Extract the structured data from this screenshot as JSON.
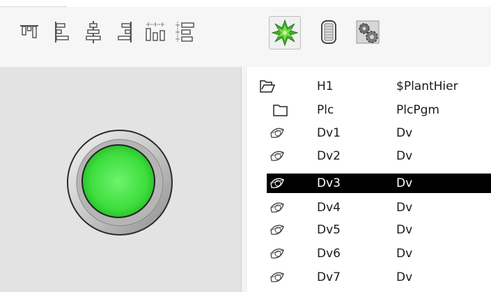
{
  "toolbar": {
    "buttons": [
      {
        "icon": "align-top-icon"
      },
      {
        "icon": "align-left-icon"
      },
      {
        "icon": "align-center-vertical-icon"
      },
      {
        "icon": "align-right-icon"
      },
      {
        "icon": "distribute-horizontal-icon"
      },
      {
        "icon": "distribute-vertical-icon"
      },
      {
        "icon": "starburst-icon",
        "active": true
      },
      {
        "icon": "scroll-panel-icon"
      },
      {
        "icon": "gears-icon"
      }
    ]
  },
  "indicator": {
    "state": "on",
    "color": "#2fd12f"
  },
  "tree": {
    "rows": [
      {
        "icon": "open-folder-icon",
        "name": "H1",
        "class": "$PlantHier",
        "selected": false
      },
      {
        "icon": "folder-icon",
        "name": "Plc",
        "class": "PlcPgm",
        "selected": false
      },
      {
        "icon": "leaf-icon",
        "name": "Dv1",
        "class": "Dv",
        "selected": false
      },
      {
        "icon": "leaf-icon",
        "name": "Dv2",
        "class": "Dv",
        "selected": false
      },
      {
        "icon": "leaf-icon",
        "name": "Dv3",
        "class": "Dv",
        "selected": true
      },
      {
        "icon": "leaf-icon",
        "name": "Dv4",
        "class": "Dv",
        "selected": false
      },
      {
        "icon": "leaf-icon",
        "name": "Dv5",
        "class": "Dv",
        "selected": false
      },
      {
        "icon": "leaf-icon",
        "name": "Dv6",
        "class": "Dv",
        "selected": false
      },
      {
        "icon": "leaf-icon",
        "name": "Dv7",
        "class": "Dv",
        "selected": false
      }
    ]
  },
  "colors": {
    "selection_bg": "#000000",
    "selection_fg": "#ffffff",
    "pane_bg": "#e3e3e3"
  }
}
